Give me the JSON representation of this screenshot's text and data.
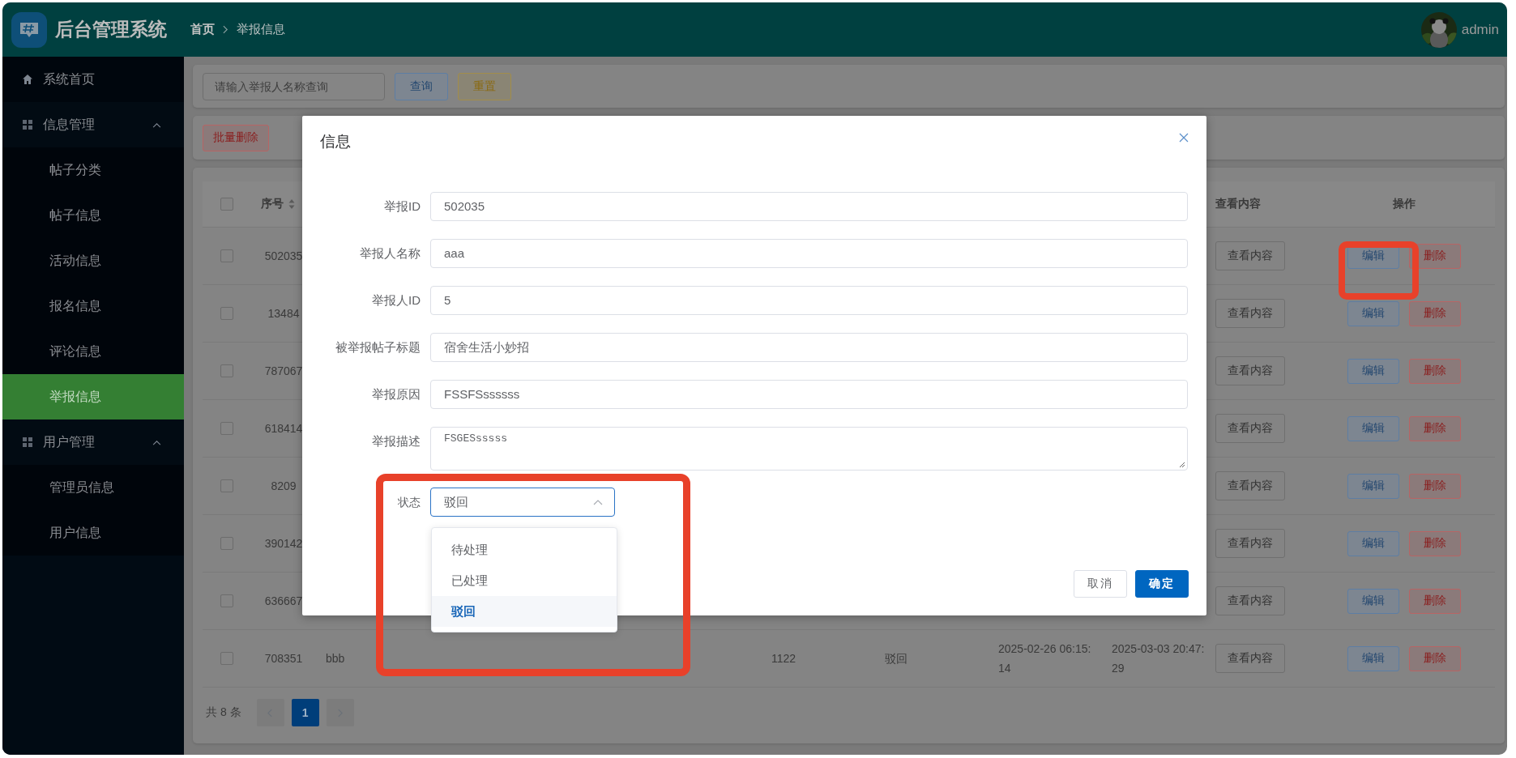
{
  "header": {
    "title": "后台管理系统",
    "breadcrumb": [
      {
        "label": "首页"
      },
      {
        "label": "举报信息"
      }
    ],
    "user": "admin"
  },
  "sidebar": {
    "items": [
      {
        "label": "系统首页",
        "kind": "home",
        "selected": false
      },
      {
        "label": "信息管理",
        "kind": "group",
        "expanded": true,
        "children": [
          {
            "label": "帖子分类",
            "selected": false
          },
          {
            "label": "帖子信息",
            "selected": false
          },
          {
            "label": "活动信息",
            "selected": false
          },
          {
            "label": "报名信息",
            "selected": false
          },
          {
            "label": "评论信息",
            "selected": false
          },
          {
            "label": "举报信息",
            "selected": true
          }
        ]
      },
      {
        "label": "用户管理",
        "kind": "group",
        "expanded": true,
        "children": [
          {
            "label": "管理员信息",
            "selected": false
          },
          {
            "label": "用户信息",
            "selected": false
          }
        ]
      }
    ]
  },
  "search": {
    "placeholder": "请输入举报人名称查询",
    "buttons": [
      {
        "label": "查询",
        "kind": "primary"
      },
      {
        "label": "重置",
        "kind": "warning"
      }
    ]
  },
  "toolbar": {
    "buttons": [
      {
        "label": "批量删除",
        "kind": "danger"
      }
    ]
  },
  "table": {
    "header_checked": false,
    "columns": [
      {
        "label": "序号",
        "sortable": true
      },
      {
        "label": "查看内容",
        "sortable": false
      },
      {
        "label": "操作",
        "sortable": false
      }
    ],
    "rows": [
      {
        "checked": false,
        "highlighted": true,
        "cells": {
          "id": "502035"
        },
        "view": "查看内容",
        "edit": "编辑",
        "delete": "删除"
      },
      {
        "checked": false,
        "highlighted": false,
        "cells": {
          "id": "13484"
        },
        "view": "查看内容",
        "edit": "编辑",
        "delete": "删除"
      },
      {
        "checked": false,
        "highlighted": false,
        "cells": {
          "id": "787067"
        },
        "view": "查看内容",
        "edit": "编辑",
        "delete": "删除"
      },
      {
        "checked": false,
        "highlighted": false,
        "cells": {
          "id": "618414"
        },
        "view": "查看内容",
        "edit": "编辑",
        "delete": "删除"
      },
      {
        "checked": false,
        "highlighted": false,
        "cells": {
          "id": "8209"
        },
        "view": "查看内容",
        "edit": "编辑",
        "delete": "删除"
      },
      {
        "checked": false,
        "highlighted": false,
        "cells": {
          "id": "390142"
        },
        "view": "查看内容",
        "edit": "编辑",
        "delete": "删除"
      },
      {
        "checked": false,
        "highlighted": false,
        "cells": {
          "id": "636667"
        },
        "view": "查看内容",
        "edit": "编辑",
        "delete": "删除"
      },
      {
        "checked": false,
        "highlighted": false,
        "cells": {
          "id": "708351",
          "column_3": "bbb",
          "column_6": "1122",
          "column_7": "驳回",
          "column_8": "2025-02-26 06:15:14",
          "column_9": "2025-03-03 20:47:29"
        },
        "view": "查看内容",
        "edit": "编辑",
        "delete": "删除"
      }
    ]
  },
  "pagination": {
    "total": "共 8 条",
    "pages": [
      {
        "label": "1",
        "selected": true
      }
    ]
  },
  "dialog": {
    "title": "信息",
    "fields": [
      {
        "label": "举报ID",
        "value": "502035",
        "kind": "input"
      },
      {
        "label": "举报人名称",
        "value": "aaa",
        "kind": "input"
      },
      {
        "label": "举报人ID",
        "value": "5",
        "kind": "input"
      },
      {
        "label": "被举报帖子标题",
        "value": "宿舍生活小妙招",
        "kind": "input"
      },
      {
        "label": "举报原因",
        "value": "FSSFSssssss",
        "kind": "input"
      },
      {
        "label": "举报描述",
        "value": "FSGESsssss",
        "kind": "textarea"
      },
      {
        "label": "状态",
        "value": "驳回",
        "kind": "select",
        "expanded": true,
        "highlighted": true,
        "options": [
          {
            "label": "待处理",
            "selected": false
          },
          {
            "label": "已处理",
            "selected": false
          },
          {
            "label": "驳回",
            "selected": true
          }
        ]
      }
    ],
    "buttons": [
      {
        "label": "取消",
        "kind": "default"
      },
      {
        "label": "确定",
        "kind": "primary"
      }
    ]
  }
}
